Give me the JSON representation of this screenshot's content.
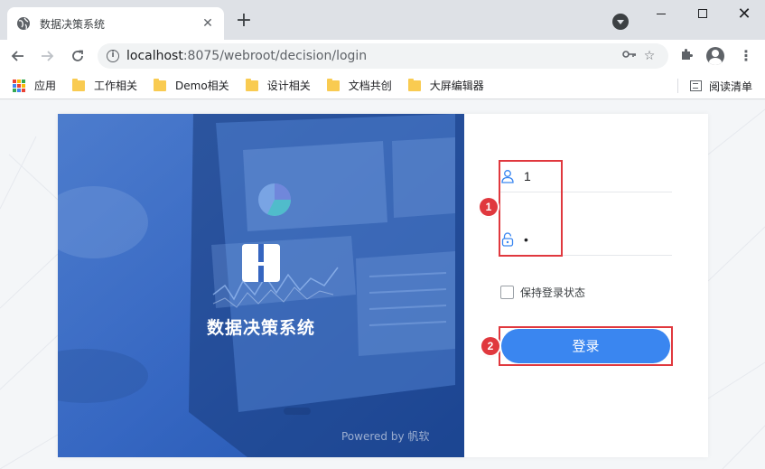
{
  "browser": {
    "tab_title": "数据决策系统",
    "tab_close": "✕",
    "new_tab": "+",
    "url_host": "localhost",
    "url_path": ":8075/webroot/decision/login",
    "window_controls": {
      "close": "✕"
    }
  },
  "bookmarks": {
    "apps_label": "应用",
    "items": [
      {
        "label": "工作相关"
      },
      {
        "label": "Demo相关"
      },
      {
        "label": "设计相关"
      },
      {
        "label": "文档共创"
      },
      {
        "label": "大屏编辑器"
      }
    ],
    "reading_list": "阅读清单"
  },
  "hero": {
    "title": "数据决策系统",
    "powered_by": "Powered by 帆软"
  },
  "login": {
    "username_value": "1",
    "password_value": "•",
    "remember_label": "保持登录状态",
    "submit_label": "登录",
    "annotation_1": "1",
    "annotation_2": "2"
  },
  "colors": {
    "primary": "#3a86f0",
    "hero_blue": "#2f64c9",
    "annotation_red": "#e0383e"
  }
}
